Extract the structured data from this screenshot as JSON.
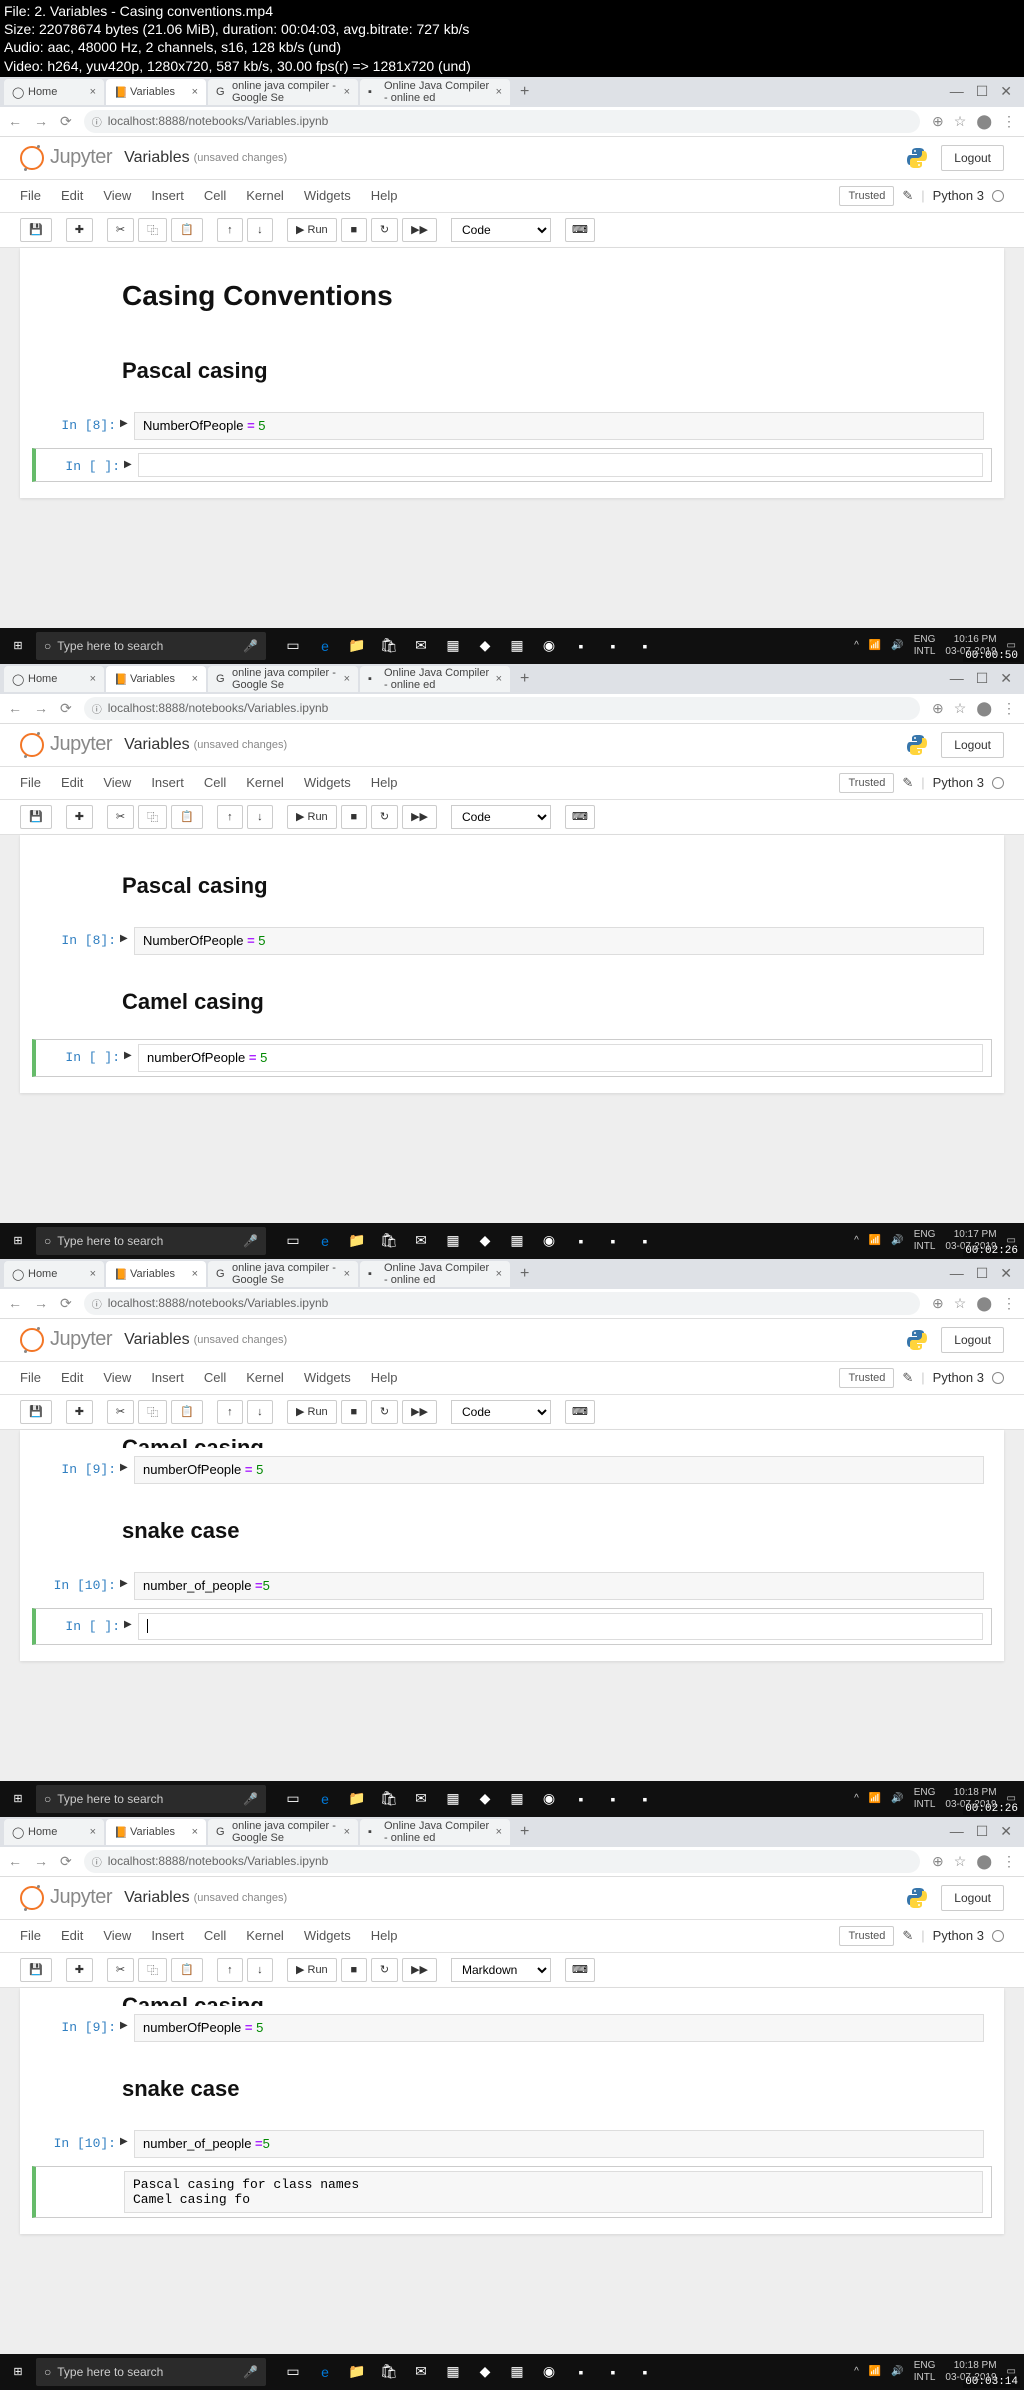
{
  "video_info": {
    "file": "File: 2. Variables - Casing conventions.mp4",
    "size": "Size: 22078674 bytes (21.06 MiB), duration: 00:04:03, avg.bitrate: 727 kb/s",
    "audio": "Audio: aac, 48000 Hz, 2 channels, s16, 128 kb/s (und)",
    "video": "Video: h264, yuv420p, 1280x720, 587 kb/s, 30.00 fps(r) => 1281x720 (und)"
  },
  "browser": {
    "tabs": [
      {
        "label": "Home"
      },
      {
        "label": "Variables"
      },
      {
        "label": "online java compiler - Google Se"
      },
      {
        "label": "Online Java Compiler - online ed"
      }
    ],
    "url": "localhost:8888/notebooks/Variables.ipynb",
    "new_tab": "+",
    "close": "×",
    "min": "—",
    "max": "☐",
    "x": "✕"
  },
  "jupyter": {
    "logo": "Jupyter",
    "notebook": "Variables",
    "status": "(unsaved changes)",
    "logout": "Logout",
    "menus": [
      "File",
      "Edit",
      "View",
      "Insert",
      "Cell",
      "Kernel",
      "Widgets",
      "Help"
    ],
    "trusted": "Trusted",
    "kernel": "Python 3",
    "toolbar": {
      "save": "💾",
      "add": "✚",
      "cut": "✂",
      "copy": "⿻",
      "paste": "📋",
      "up": "↑",
      "down": "↓",
      "run": "▶ Run",
      "stop": "■",
      "restart": "↻",
      "ff": "▶▶",
      "celltype_code": "Code",
      "celltype_md": "Markdown",
      "keyboard": "⌨"
    }
  },
  "frame1": {
    "h1": "Casing Conventions",
    "h2": "Pascal casing",
    "prompt1": "In [8]:",
    "code1_var": "NumberOfPeople",
    "code1_eq": " = ",
    "code1_val": "5",
    "prompt2": "In [ ]:",
    "time": "10:16 PM",
    "date": "03-07-2019",
    "ts": "00:00:50"
  },
  "frame2": {
    "h2a": "Pascal casing",
    "h2b": "Camel casing",
    "prompt1": "In [8]:",
    "code1_var": "NumberOfPeople",
    "code1_eq": " = ",
    "code1_val": "5",
    "prompt2": "In [ ]:",
    "code2_var": "numberOfPeople",
    "code2_eq": " = ",
    "code2_val": "5",
    "time": "10:17 PM",
    "date": "03-07-2019",
    "ts": "00:02:26"
  },
  "frame3": {
    "h_cut": "Camel casing",
    "h2": "snake case",
    "prompt1": "In [9]:",
    "code1_var": "numberOfPeople",
    "code1_eq": " = ",
    "code1_val": "5",
    "prompt2": "In [10]:",
    "code2_var": "number_of_people",
    "code2_eq": " =",
    "code2_val": "5",
    "prompt3": "In [ ]:",
    "time": "10:18 PM",
    "date": "03-07-2019",
    "ts": "00:02:26"
  },
  "frame4": {
    "h_cut": "Camel casing",
    "h2": "snake case",
    "prompt1": "In [9]:",
    "code1_var": "numberOfPeople",
    "code1_eq": " = ",
    "code1_val": "5",
    "prompt2": "In [10]:",
    "code2_var": "number_of_people",
    "code2_eq": " =",
    "code2_val": "5",
    "md_text": "Pascal casing for class names\nCamel casing fo",
    "time": "10:18 PM",
    "date": "03-07-2019",
    "ts": "00:03:14"
  },
  "taskbar": {
    "search": "Type here to search",
    "lang1": "ENG",
    "lang2": "INTL"
  }
}
